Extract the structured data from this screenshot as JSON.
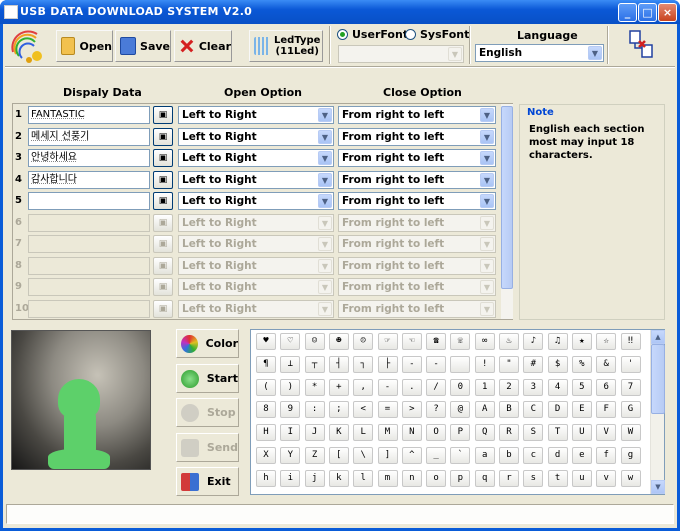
{
  "window": {
    "title": "USB DATA DOWNLOAD SYSTEM V2.0"
  },
  "toolbar": {
    "open": "Open",
    "save": "Save",
    "clear": "Clear",
    "ledtype_line1": "LedType",
    "ledtype_line2": "(11Led)"
  },
  "font": {
    "user": "UserFont",
    "sys": "SysFont",
    "selected": "UserFont"
  },
  "language": {
    "label": "Language",
    "value": "English"
  },
  "columns": {
    "display": "Dispaly Data",
    "open": "Open Option",
    "close": "Close Option"
  },
  "rows": [
    {
      "num": "1",
      "text": "FANTASTIC",
      "open": "Left to Right",
      "close": "From right to left",
      "enabled": true
    },
    {
      "num": "2",
      "text": "메세지 선풍기",
      "open": "Left to Right",
      "close": "From right to left",
      "enabled": true
    },
    {
      "num": "3",
      "text": "안녕하세요",
      "open": "Left to Right",
      "close": "From right to left",
      "enabled": true
    },
    {
      "num": "4",
      "text": "감사합니다",
      "open": "Left to Right",
      "close": "From right to left",
      "enabled": true
    },
    {
      "num": "5",
      "text": "",
      "open": "Left to Right",
      "close": "From right to left",
      "enabled": true
    },
    {
      "num": "6",
      "text": "",
      "open": "Left to Right",
      "close": "From right to left",
      "enabled": false
    },
    {
      "num": "7",
      "text": "",
      "open": "Left to Right",
      "close": "From right to left",
      "enabled": false
    },
    {
      "num": "8",
      "text": "",
      "open": "Left to Right",
      "close": "From right to left",
      "enabled": false
    },
    {
      "num": "9",
      "text": "",
      "open": "Left to Right",
      "close": "From right to left",
      "enabled": false
    },
    {
      "num": "10",
      "text": "",
      "open": "Left to Right",
      "close": "From right to left",
      "enabled": false
    }
  ],
  "note": {
    "title": "Note",
    "body": "English each section most may input 18 characters."
  },
  "actions": {
    "color": "Color",
    "start": "Start",
    "stop": "Stop",
    "send": "Send",
    "exit": "Exit"
  },
  "charmap": [
    [
      "♥",
      "♡",
      "☺",
      "☻",
      "☹",
      "☞",
      "☜",
      "☎",
      "☏",
      "∞",
      "♨",
      "♪",
      "♫",
      "★",
      "☆",
      "‼"
    ],
    [
      "¶",
      "⊥",
      "┬",
      "┤",
      "┐",
      "├",
      "‐",
      "‑",
      "",
      "!",
      "\"",
      "#",
      "$",
      "%",
      "&",
      "'"
    ],
    [
      "(",
      ")",
      "*",
      "+",
      ",",
      "-",
      ".",
      "/",
      "0",
      "1",
      "2",
      "3",
      "4",
      "5",
      "6",
      "7"
    ],
    [
      "8",
      "9",
      ":",
      ";",
      "<",
      "=",
      ">",
      "?",
      "@",
      "A",
      "B",
      "C",
      "D",
      "E",
      "F",
      "G"
    ],
    [
      "H",
      "I",
      "J",
      "K",
      "L",
      "M",
      "N",
      "O",
      "P",
      "Q",
      "R",
      "S",
      "T",
      "U",
      "V",
      "W"
    ],
    [
      "X",
      "Y",
      "Z",
      "[",
      "\\",
      "]",
      "^",
      "_",
      "`",
      "a",
      "b",
      "c",
      "d",
      "e",
      "f",
      "g"
    ],
    [
      "h",
      "i",
      "j",
      "k",
      "l",
      "m",
      "n",
      "o",
      "p",
      "q",
      "r",
      "s",
      "t",
      "u",
      "v",
      "w"
    ]
  ],
  "status": {
    "text": ""
  }
}
